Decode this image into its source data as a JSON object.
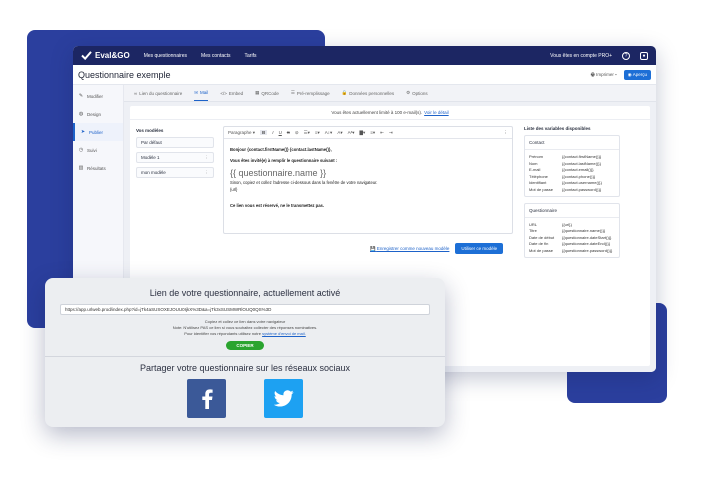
{
  "topbar": {
    "logo_text": "Eval&GO",
    "nav": [
      "Mes questionnaires",
      "Mes contacts",
      "Tarifs"
    ],
    "account_text": "Vous êtes en compte PRO+",
    "help_icon": "help-icon",
    "user_icon": "user-icon"
  },
  "header": {
    "title": "Questionnaire exemple",
    "print_label": "Imprimer",
    "preview_label": "Aperçu"
  },
  "sidenav": {
    "items": [
      {
        "label": "Modifier",
        "icon": "pencil-icon"
      },
      {
        "label": "Design",
        "icon": "palette-icon"
      },
      {
        "label": "Publier",
        "icon": "share-icon"
      },
      {
        "label": "Suivi",
        "icon": "clock-icon"
      },
      {
        "label": "Résultats",
        "icon": "chart-icon"
      }
    ],
    "active": "Publier"
  },
  "tabs": {
    "items": [
      "Lien du questionnaire",
      "Mail",
      "Embed",
      "QRCode",
      "Pré-remplissage",
      "Données personnelles",
      "Options"
    ],
    "active": "Mail"
  },
  "banner": {
    "text": "Vous êtes actuellement limité à 100 e-mail(s).",
    "link": "Voir le détail"
  },
  "models": {
    "heading": "Vos modèles",
    "items": [
      "Par défaut",
      "Modèle 1",
      "mon modèle"
    ]
  },
  "editor": {
    "paragraph_select": "Paragraphe",
    "greeting": "Bonjour {contact.firstName()} {contact.lastName()},",
    "invite": "Vous êtes invité(e) à remplir le questionnaire suivant :",
    "placeholder_name": "{{ questionnaire.name }}",
    "fallback": "Sinon, copiez et collez l'adresse ci-dessous dans la fenêtre de votre navigateur.",
    "url_tag": "{url}",
    "reserved": "Ce lien vous est réservé, ne le transmettez pas."
  },
  "actions": {
    "save_link": "Enregistrer comme nouveau modèle",
    "use_button": "Utiliser ce modèle"
  },
  "variables": {
    "heading": "Liste des variables disponibles",
    "contact": {
      "title": "Contact",
      "rows": [
        [
          "Prénom",
          "{{contact.firstName()}}"
        ],
        [
          "Nom",
          "{{contact.lastName()}}"
        ],
        [
          "E-mail",
          "{{contact.email()}}"
        ],
        [
          "Téléphone",
          "{{contact.phone()}}"
        ],
        [
          "Identifiant",
          "{{contact.username()}}"
        ],
        [
          "Mot de passe",
          "{{contact.password()}}"
        ]
      ]
    },
    "questionnaire": {
      "title": "Questionnaire",
      "rows": [
        [
          "URL",
          "{{url}}"
        ],
        [
          "Titre",
          "{{questionnaire.name()}}"
        ],
        [
          "Date de début",
          "{{questionnaire.dateStart()}}"
        ],
        [
          "Date de fin",
          "{{questionnaire.dateEnd()}}"
        ],
        [
          "Mot de passe",
          "{{questionnaire.password()}}"
        ]
      ]
    }
  },
  "overlay": {
    "title": "Lien de votre questionnaire, actuellement activé",
    "url": "https://app.urlweb.prod/index.php?id=jTk4aSUSOXEJOUU0IjkX%3D&a=jTk3xSUSMWRlOUQ0QS%3D",
    "note1": "Copiez et collez ce lien dans votre navigateur",
    "note2": "Note: N'utilisez PAS ce lien si vous souhaitez collecter des réponses nominatives.",
    "note3": "Pour identifier vos répondants utilisez notre",
    "note3_link": "système d'envoi de mail.",
    "copy_label": "COPIER",
    "share_title": "Partager votre questionnaire sur les réseaux sociaux",
    "social": [
      "facebook-icon",
      "twitter-icon"
    ]
  }
}
